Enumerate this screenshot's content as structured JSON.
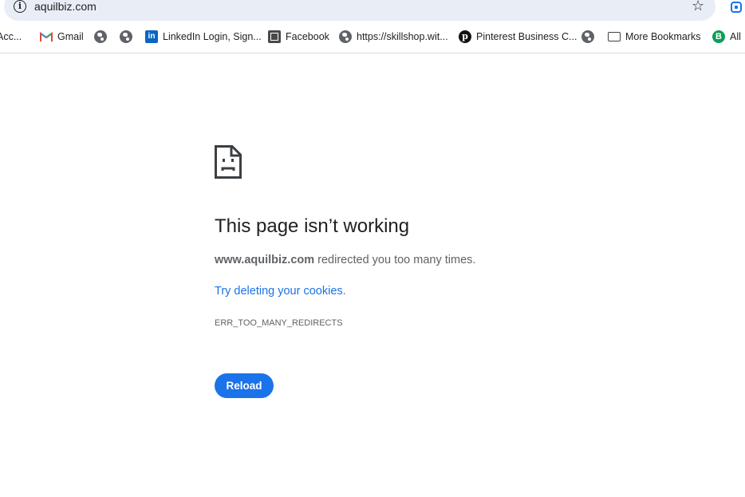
{
  "browser": {
    "url": "aquilbiz.com",
    "bookmarks": [
      {
        "label": "Acc...",
        "icon": "globe-icon"
      },
      {
        "label": "Gmail",
        "icon": "gmail-icon"
      },
      {
        "label": "",
        "icon": "globe-icon"
      },
      {
        "label": "",
        "icon": "globe-icon"
      },
      {
        "label": "LinkedIn Login, Sign...",
        "icon": "linkedin-icon"
      },
      {
        "label": "Facebook",
        "icon": "facebook-icon"
      },
      {
        "label": "https://skillshop.wit...",
        "icon": "globe-icon"
      },
      {
        "label": "Pinterest Business C...",
        "icon": "pinterest-icon"
      },
      {
        "label": "",
        "icon": "globe-icon"
      },
      {
        "label": "More Bookmarks",
        "icon": "folder-icon"
      },
      {
        "label": "All",
        "icon": "b-icon"
      }
    ]
  },
  "error": {
    "title": "This page isn’t working",
    "host": "www.aquilbiz.com",
    "message": " redirected you too many times.",
    "link": "Try deleting your cookies.",
    "code": "ERR_TOO_MANY_REDIRECTS",
    "reload_label": "Reload"
  },
  "colors": {
    "accent": "#1a73e8",
    "text": "#202124",
    "secondary": "#5f6368"
  }
}
